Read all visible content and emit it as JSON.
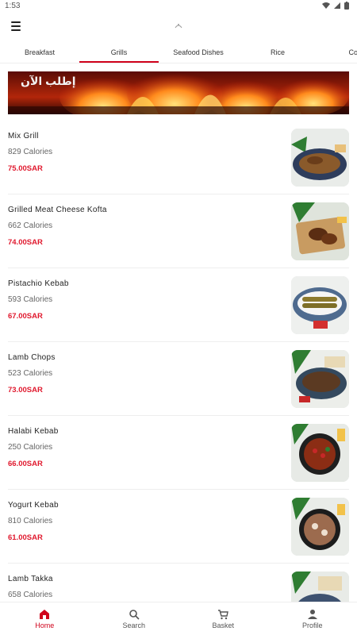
{
  "status": {
    "time": "1:53"
  },
  "tabs": [
    {
      "label": "Breakfast"
    },
    {
      "label": "Grills"
    },
    {
      "label": "Seafood Dishes"
    },
    {
      "label": "Rice"
    },
    {
      "label": "Conti"
    }
  ],
  "active_tab": "Grills",
  "banner": {
    "text": "إطلب الآن"
  },
  "items": [
    {
      "name": "Mix Grill",
      "calories": "829 Calories",
      "price": "75.00SAR"
    },
    {
      "name": "Grilled Meat Cheese Kofta",
      "calories": "662 Calories",
      "price": "74.00SAR"
    },
    {
      "name": "Pistachio Kebab",
      "calories": "593 Calories",
      "price": "67.00SAR"
    },
    {
      "name": "Lamb Chops",
      "calories": "523 Calories",
      "price": "73.00SAR"
    },
    {
      "name": "Halabi Kebab",
      "calories": "250 Calories",
      "price": "66.00SAR"
    },
    {
      "name": "Yogurt Kebab",
      "calories": "810 Calories",
      "price": "61.00SAR"
    },
    {
      "name": "Lamb Takka",
      "calories": "658 Calories",
      "price": ""
    }
  ],
  "bottom_nav": [
    {
      "label": "Home",
      "icon": "home-icon"
    },
    {
      "label": "Search",
      "icon": "search-icon"
    },
    {
      "label": "Basket",
      "icon": "cart-icon"
    },
    {
      "label": "Profile",
      "icon": "person-icon"
    }
  ],
  "colors": {
    "accent": "#d0021b",
    "price": "#e0192e"
  }
}
